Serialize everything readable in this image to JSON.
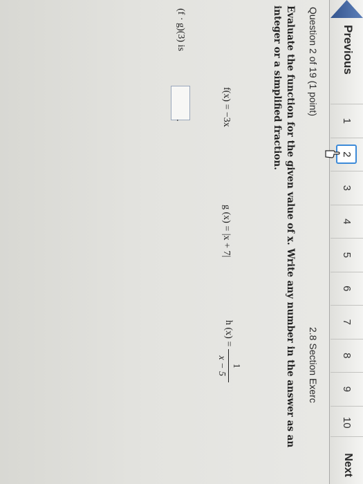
{
  "nav": {
    "previous_label": "Previous",
    "next_label": "Next",
    "pages": [
      "1",
      "2",
      "3",
      "4",
      "5",
      "6",
      "7",
      "8",
      "9",
      "10"
    ],
    "current_page": "2"
  },
  "question": {
    "info": "Question 2 of 19 (1 point)",
    "section": "2.8 Section Exerc",
    "instructions": "Evaluate the function for the given value of x. Write any number in the answer as an integer or a simplified fraction.",
    "f": "f(x) = −3x",
    "g": "g (x) = |x + 7|",
    "h_label": "h (x) =",
    "h_numerator": "1",
    "h_denominator": "x − 5",
    "ask": "(f · g)(3) is",
    "answer_value": "",
    "period": "."
  },
  "colors": {
    "nav_arrow": "#34558e",
    "active_page_border": "#3c8ad8"
  },
  "icons": [
    "previous-arrow-icon",
    "hand-cursor-icon"
  ]
}
